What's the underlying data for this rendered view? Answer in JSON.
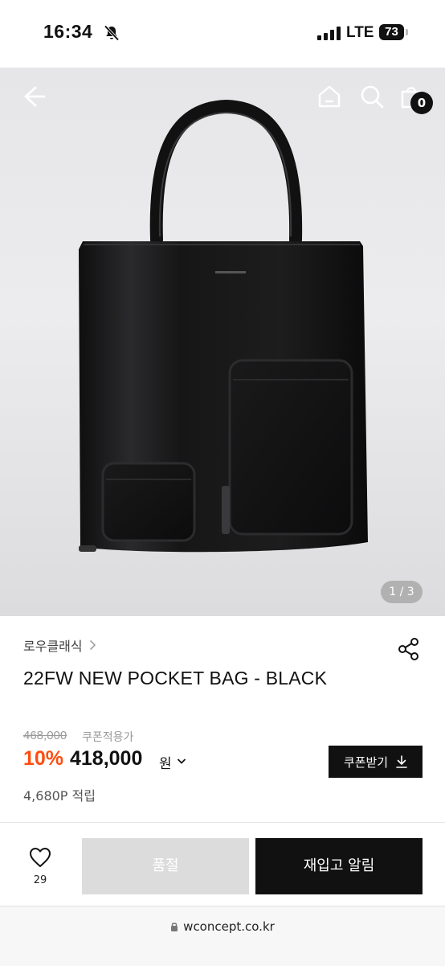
{
  "status_bar": {
    "time": "16:34",
    "network": "LTE",
    "battery": "73"
  },
  "gallery": {
    "counter": "1 / 3",
    "cart_count": "0"
  },
  "product": {
    "brand": "로우클래식",
    "name": "22FW NEW POCKET BAG - BLACK",
    "original_price": "468,000",
    "coupon_note": "쿠폰적용가",
    "discount": "10%",
    "price": "418,000",
    "currency": "원",
    "coupon_button": "쿠폰받기",
    "points": "4,680P 적립"
  },
  "bottom_bar": {
    "like_count": "29",
    "soldout_label": "품절",
    "restock_label": "재입고 알림"
  },
  "browser": {
    "url": "wconcept.co.kr"
  },
  "colors": {
    "accent": "#ff4d0f",
    "primary": "#111111",
    "disabled": "#dcdcdc"
  },
  "icons": [
    "bell-slash-icon",
    "back-arrow-icon",
    "home-icon",
    "search-icon",
    "shopping-bag-icon",
    "share-icon",
    "chevron-right-icon",
    "chevron-down-icon",
    "download-icon",
    "heart-icon",
    "lock-icon"
  ]
}
